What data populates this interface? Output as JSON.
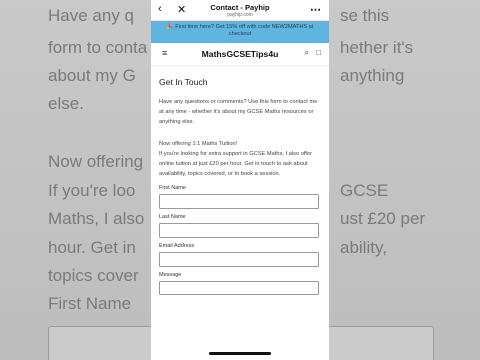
{
  "background": {
    "lines_left": [
      "Have any q",
      "form to conta",
      "about my G",
      "else.",
      "Now offering",
      "If you're loo",
      "Maths, I also",
      "hour. Get in",
      "topics cover",
      "First Name"
    ],
    "lines_right": [
      "se this",
      "hether it's",
      "anything",
      "",
      "",
      "GCSE",
      "ust £20 per",
      "ability,",
      "",
      ""
    ]
  },
  "browser": {
    "back_icon": "back-arrow-icon",
    "close_icon": "close-icon",
    "more_icon": "more-icon",
    "title": "Contact - Payhip",
    "url": "payhip.com"
  },
  "promo": {
    "text": "🎉 First time here? Get 15% off with code NEW2MATHS at checkout"
  },
  "store": {
    "brand": "MathsGCSETips4u",
    "menu_icon": "menu-icon",
    "search_icon": "search-icon",
    "cart_icon": "bag-icon"
  },
  "page": {
    "heading": "Get In Touch",
    "intro": "Have any questions or comments? Use this form to contact me at any time - whether it's about my GCSE Maths resources or anything else.",
    "offer_title": "Now offering 1:1 Maths Tuition!",
    "offer_body": "If you're looking for extra support in GCSE Maths, I also offer online tuition at just £20 per hour. Get in touch to ask about availability, topics covered, or to book a session."
  },
  "form": {
    "first_name_label": "First Name",
    "last_name_label": "Last Name",
    "email_label": "Email Address",
    "message_label": "Message"
  }
}
